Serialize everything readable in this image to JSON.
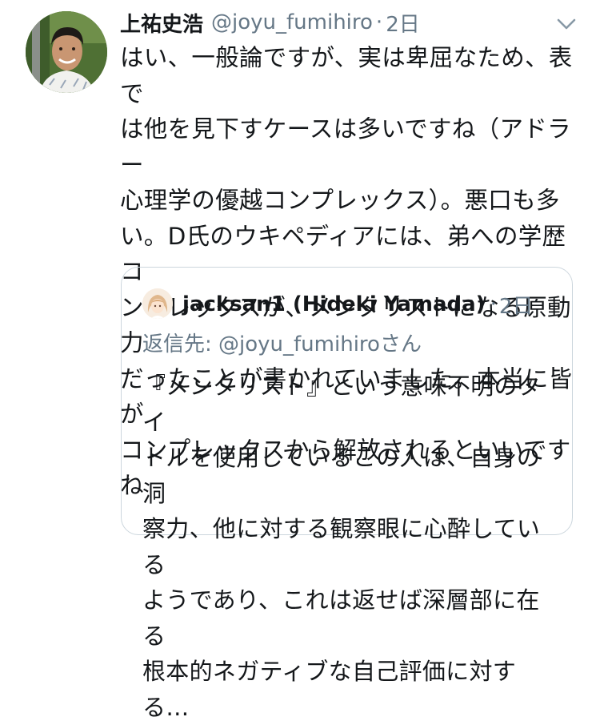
{
  "tweet": {
    "display_name": "上祐史浩",
    "handle": "@joyu_fumihiro",
    "separator": "·",
    "time": "2日",
    "text": "はい、一般論ですが、実は卑屈なため、表では他を見下すケースは多いですね（アドラー心理学の優越コンプレックス）。悪口も多い。D氏のウキペディアには、弟への学歴コンプレックスが、メンタリストになる原動力だったことが書かれていました。本当に皆がコンプレックスから解放されるといいですね",
    "text_lines": [
      "はい、一般論ですが、実は卑屈なため、表で",
      "は他を見下すケースは多いですね（アドラー",
      "心理学の優越コンプレックス）。悪口も多",
      "い。D氏のウキペディアには、弟への学歴コ",
      "ンプレックスが、メンタリストになる原動力",
      "だったことが書かれていました。本当に皆が",
      "コンプレックスから解放されるといいですね"
    ],
    "menu_icon": "chevron-down-icon"
  },
  "quoted_tweet": {
    "display_name": "jacksan1 (Hideki Yamada)",
    "separator": "·",
    "time": "2日",
    "reply_prefix": "返信先: ",
    "reply_mention": "@joyu_fumihiroさん",
    "text_lines": [
      "『メンタリスト』という意味不明のタイ",
      "トルを使用しているこの人は、自身の洞",
      "察力、他に対する観察眼に心酔している",
      "ようであり、これは返せば深層部に在る",
      "根本的ネガティブな自己評価に対する…"
    ]
  },
  "colors": {
    "text": "#14171a",
    "secondary": "#657786",
    "border": "#ccd6dd"
  }
}
